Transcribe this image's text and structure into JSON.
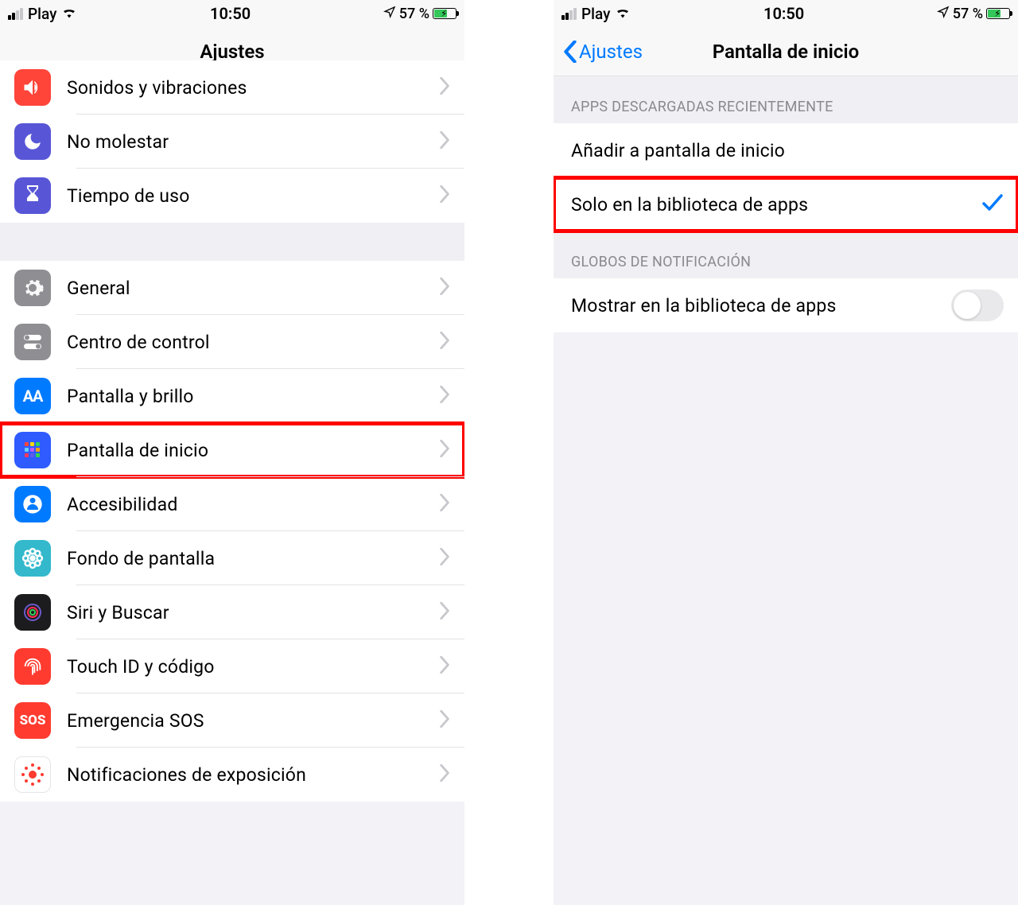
{
  "status": {
    "carrier": "Play",
    "time": "10:50",
    "battery_pct": "57 %"
  },
  "left": {
    "title": "Ajustes",
    "section1": [
      {
        "label": "Sonidos y vibraciones",
        "icon": "speaker",
        "bg": "#ff3b30"
      },
      {
        "label": "No molestar",
        "icon": "moon",
        "bg": "#5856d6"
      },
      {
        "label": "Tiempo de uso",
        "icon": "hourglass",
        "bg": "#5856d6"
      }
    ],
    "section2": [
      {
        "label": "General",
        "icon": "gear",
        "bg": "#8e8e93"
      },
      {
        "label": "Centro de control",
        "icon": "switches",
        "bg": "#8e8e93"
      },
      {
        "label": "Pantalla y brillo",
        "icon": "AA",
        "bg": "#007aff"
      },
      {
        "label": "Pantalla de inicio",
        "icon": "grid",
        "bg": "#2f5bff",
        "hl": true
      },
      {
        "label": "Accesibilidad",
        "icon": "person",
        "bg": "#007aff"
      },
      {
        "label": "Fondo de pantalla",
        "icon": "flower",
        "bg": "#33b8cc"
      },
      {
        "label": "Siri y Buscar",
        "icon": "siri",
        "bg": "#1c1c1e"
      },
      {
        "label": "Touch ID y código",
        "icon": "finger",
        "bg": "#ff3b30"
      },
      {
        "label": "Emergencia SOS",
        "icon": "sos",
        "bg": "#ff3b30"
      },
      {
        "label": "Notificaciones de exposición",
        "icon": "exposure",
        "bg": "#ffffff"
      }
    ]
  },
  "right": {
    "title": "Pantalla de inicio",
    "back": "Ajustes",
    "sectionA_header": "APPS DESCARGADAS RECIENTEMENTE",
    "sectionA": [
      {
        "label": "Añadir a pantalla de inicio",
        "checked": false
      },
      {
        "label": "Solo en la biblioteca de apps",
        "checked": true,
        "hl": true
      }
    ],
    "sectionB_header": "GLOBOS DE NOTIFICACIÓN",
    "sectionB": [
      {
        "label": "Mostrar en la biblioteca de apps",
        "toggle": false
      }
    ]
  }
}
